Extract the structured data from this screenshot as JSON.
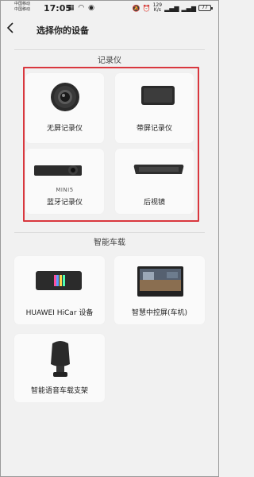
{
  "status_bar": {
    "carrier1": "中国移动",
    "carrier2": "中国移动",
    "time": "17:05",
    "net_speed_value": "129",
    "net_speed_unit": "K/s",
    "battery": "77"
  },
  "header": {
    "back_icon": "chevron-left-icon",
    "title": "选择你的设备"
  },
  "sections": [
    {
      "title": "记录仪",
      "items": [
        {
          "label": "无屏记录仪",
          "icon": "round-dashcam-icon"
        },
        {
          "label": "带屏记录仪",
          "icon": "screen-dashcam-icon"
        },
        {
          "label": "蓝牙记录仪",
          "sub": "MINI5",
          "icon": "bluetooth-dashcam-icon"
        },
        {
          "label": "后视镜",
          "icon": "rearview-mirror-icon"
        }
      ]
    },
    {
      "title": "智能车载",
      "items": [
        {
          "label": "HUAWEI HiCar 设备",
          "icon": "hicar-device-icon"
        },
        {
          "label": "智慧中控屏(车机)",
          "icon": "center-console-screen-icon"
        },
        {
          "label": "智能语音车载支架",
          "icon": "voice-car-mount-icon"
        }
      ]
    }
  ],
  "colors": {
    "highlight": "#d9373e",
    "background": "#f1f1f1",
    "card": "#fafafa"
  }
}
